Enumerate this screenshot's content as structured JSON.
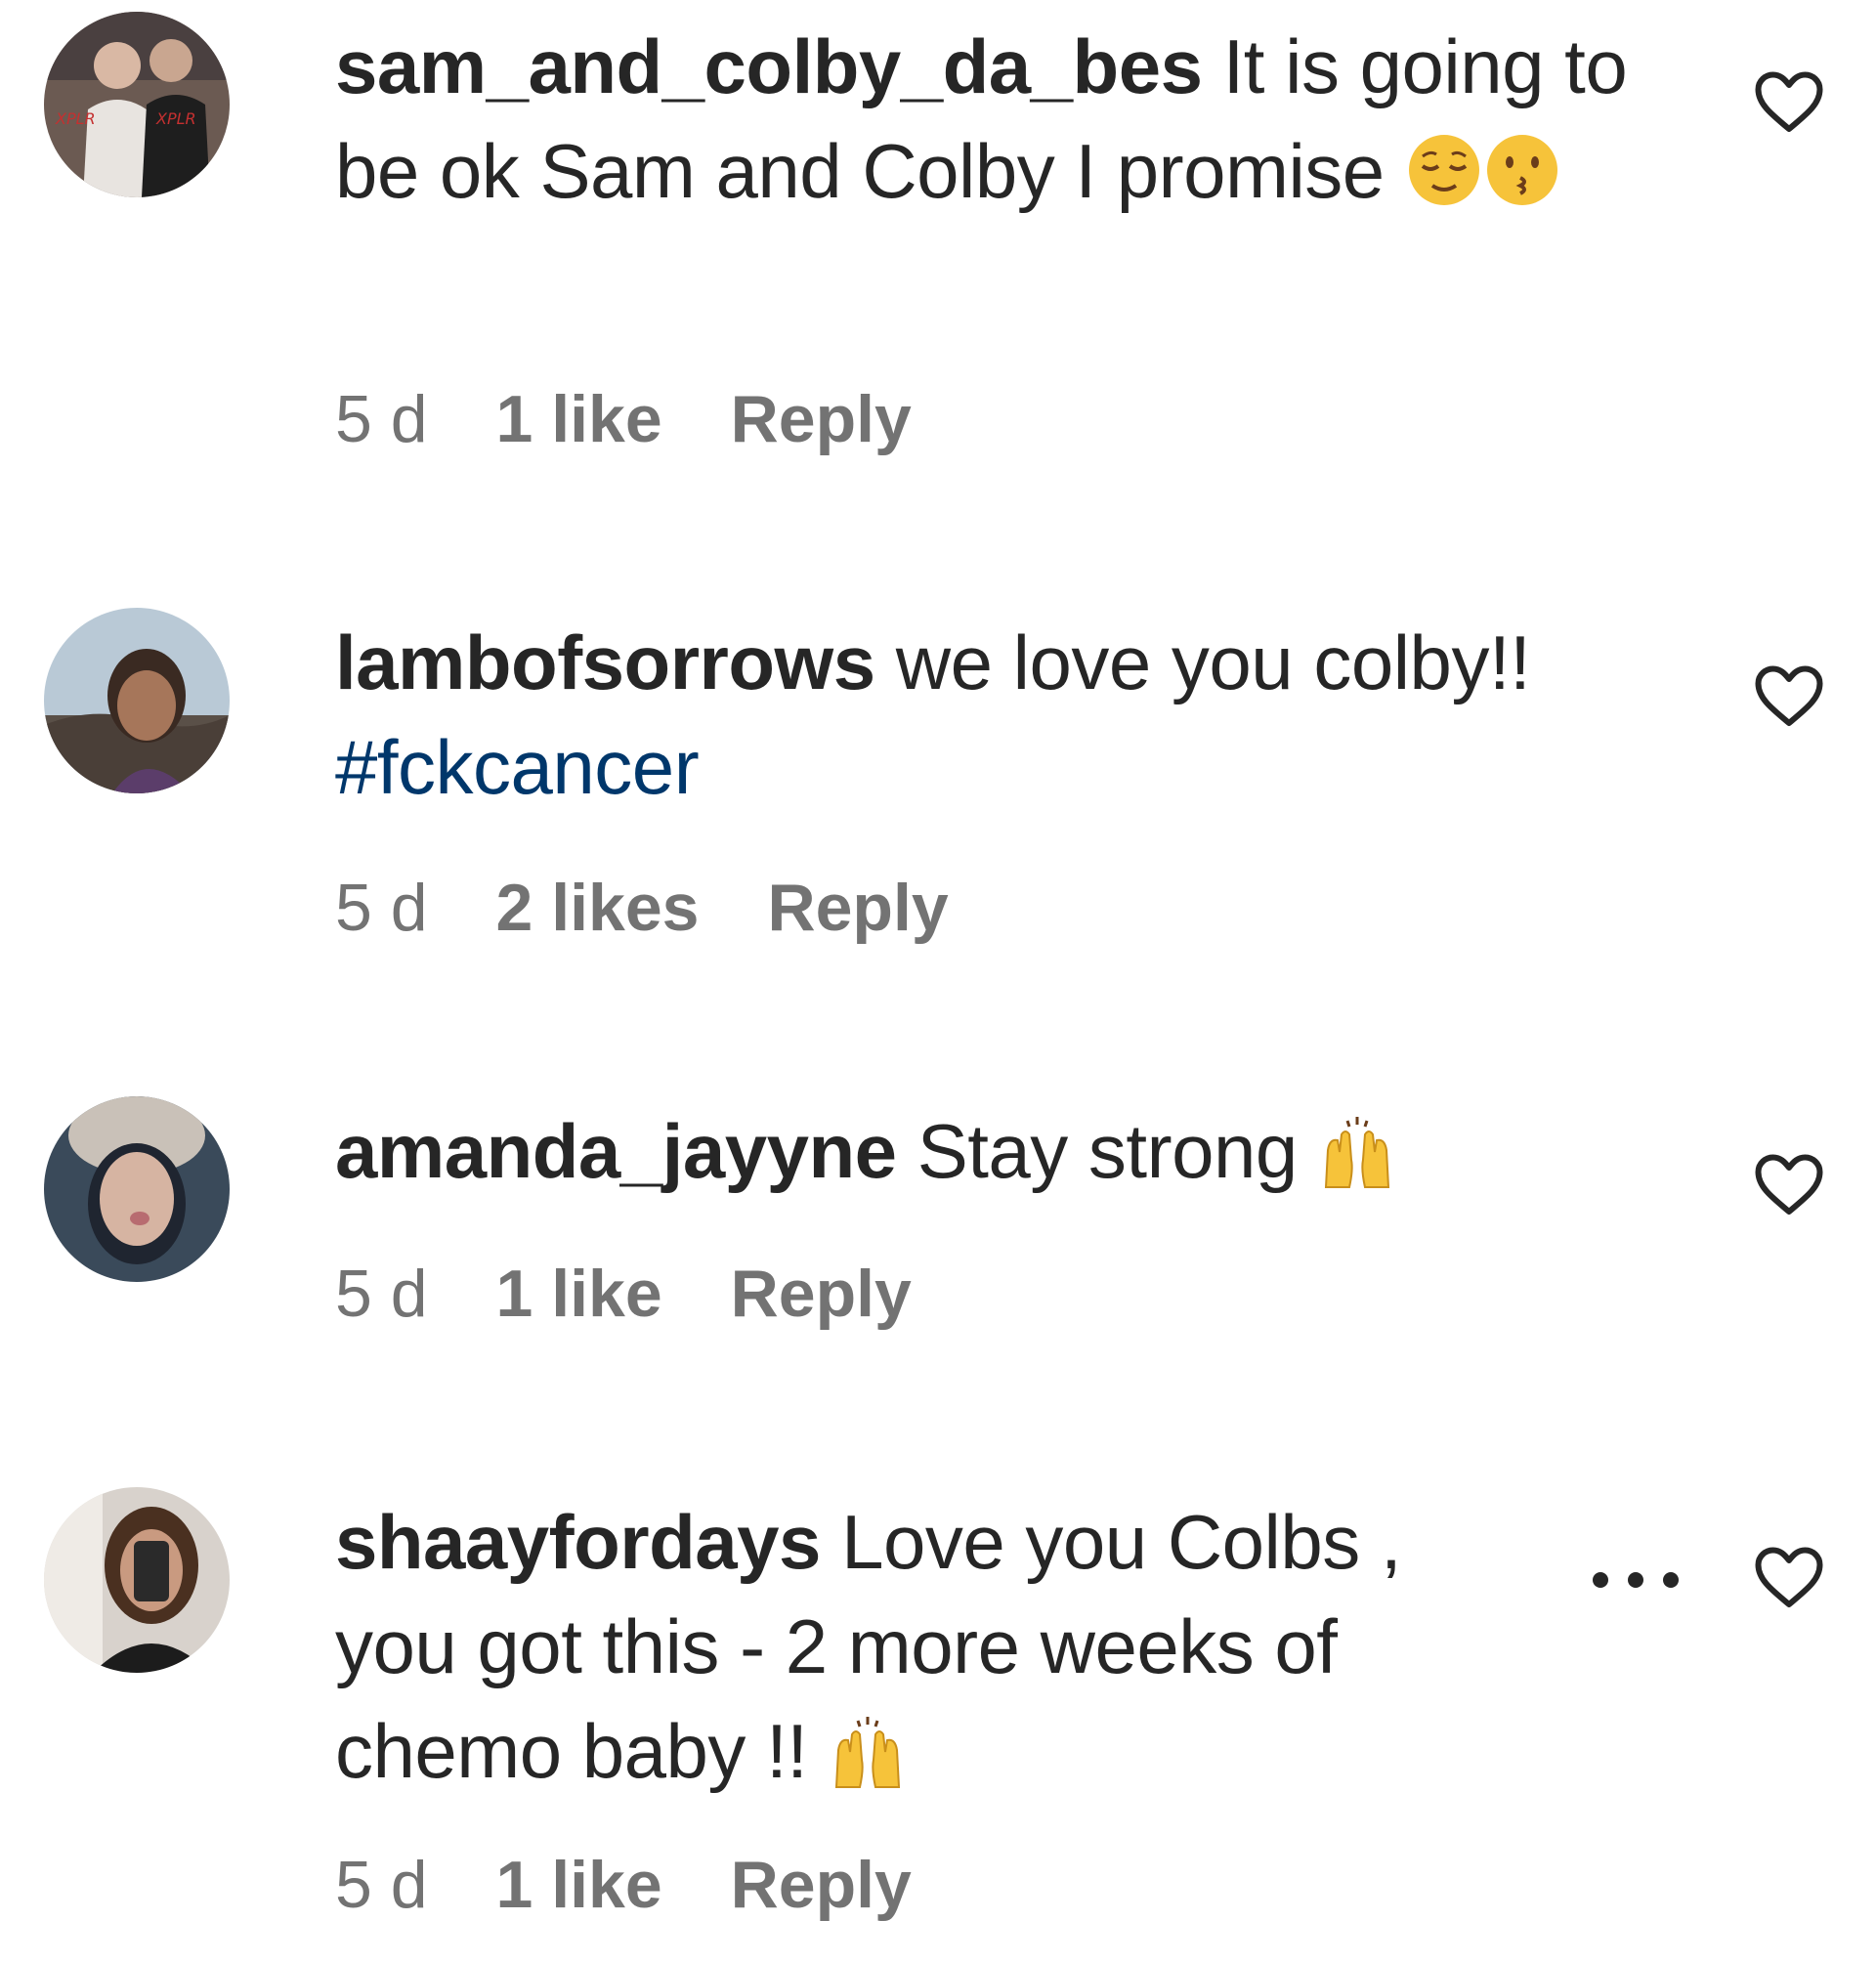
{
  "comments": [
    {
      "username": "sam_and_colby_da_bes",
      "text": "It is going to be ok Sam and Colby I promise",
      "emojis": [
        "relieved-face",
        "kissing-face"
      ],
      "time": "5 d",
      "likes": "1 like",
      "reply": "Reply"
    },
    {
      "username": "lambofsorrows",
      "text": "we love you colby!!",
      "hashtag": "#fckcancer",
      "time": "5 d",
      "likes": "2 likes",
      "reply": "Reply"
    },
    {
      "username": "amanda_jayyne",
      "text": "Stay strong",
      "emojis": [
        "raising-hands"
      ],
      "time": "5 d",
      "likes": "1 like",
      "reply": "Reply"
    },
    {
      "username": "shaayfordays",
      "text": "Love you Colbs , you got this - 2 more weeks of chemo baby !!",
      "emojis": [
        "raising-hands"
      ],
      "time": "5 d",
      "likes": "1 like",
      "reply": "Reply"
    }
  ],
  "icons": {
    "like": "heart-outline-icon",
    "more": "more-options-icon"
  },
  "colors": {
    "text": "#262626",
    "meta": "#737373",
    "hashtag": "#00376b"
  }
}
